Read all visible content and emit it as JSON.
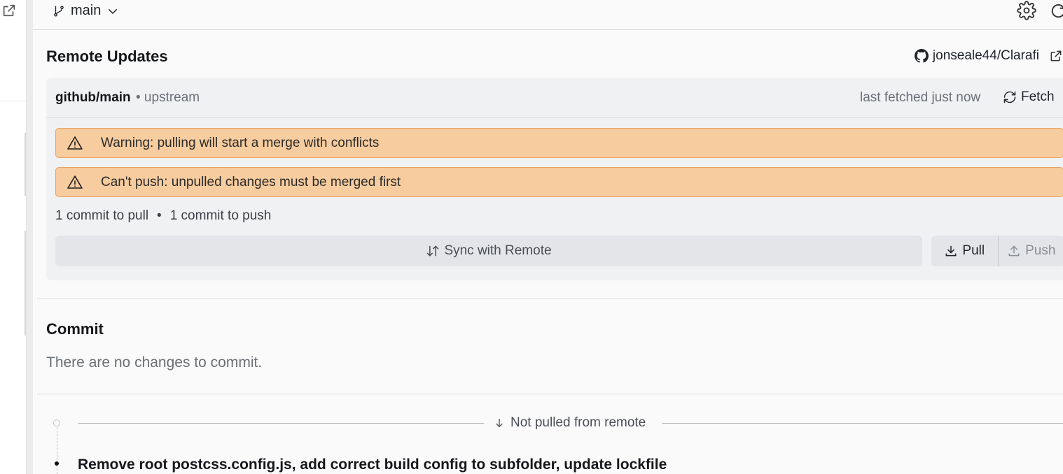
{
  "topbar": {
    "branch": "main"
  },
  "remote_updates": {
    "title": "Remote Updates",
    "repo": "jonseale44/Clarafi",
    "remote_name": "github/main",
    "remote_sub": "• upstream",
    "last_fetched": "last fetched just now",
    "fetch_label": "Fetch",
    "warnings": [
      "Warning: pulling will start a merge with conflicts",
      "Can't push: unpulled changes must be merged first"
    ],
    "commits_to_pull": "1 commit to pull",
    "separator": "•",
    "commits_to_push": "1 commit to push",
    "sync_label": "Sync with Remote",
    "pull_label": "Pull",
    "push_label": "Push"
  },
  "commit": {
    "title": "Commit",
    "empty_message": "There are no changes to commit."
  },
  "history": {
    "not_pulled_label": "Not pulled from remote",
    "commits": [
      {
        "message": "Remove root postcss.config.js, add correct build config to subfolder, update lockfile"
      }
    ]
  },
  "colors": {
    "warning_bg": "#f7cc9e",
    "warning_border": "#e6a466",
    "card_bg": "#f0f1f3"
  }
}
